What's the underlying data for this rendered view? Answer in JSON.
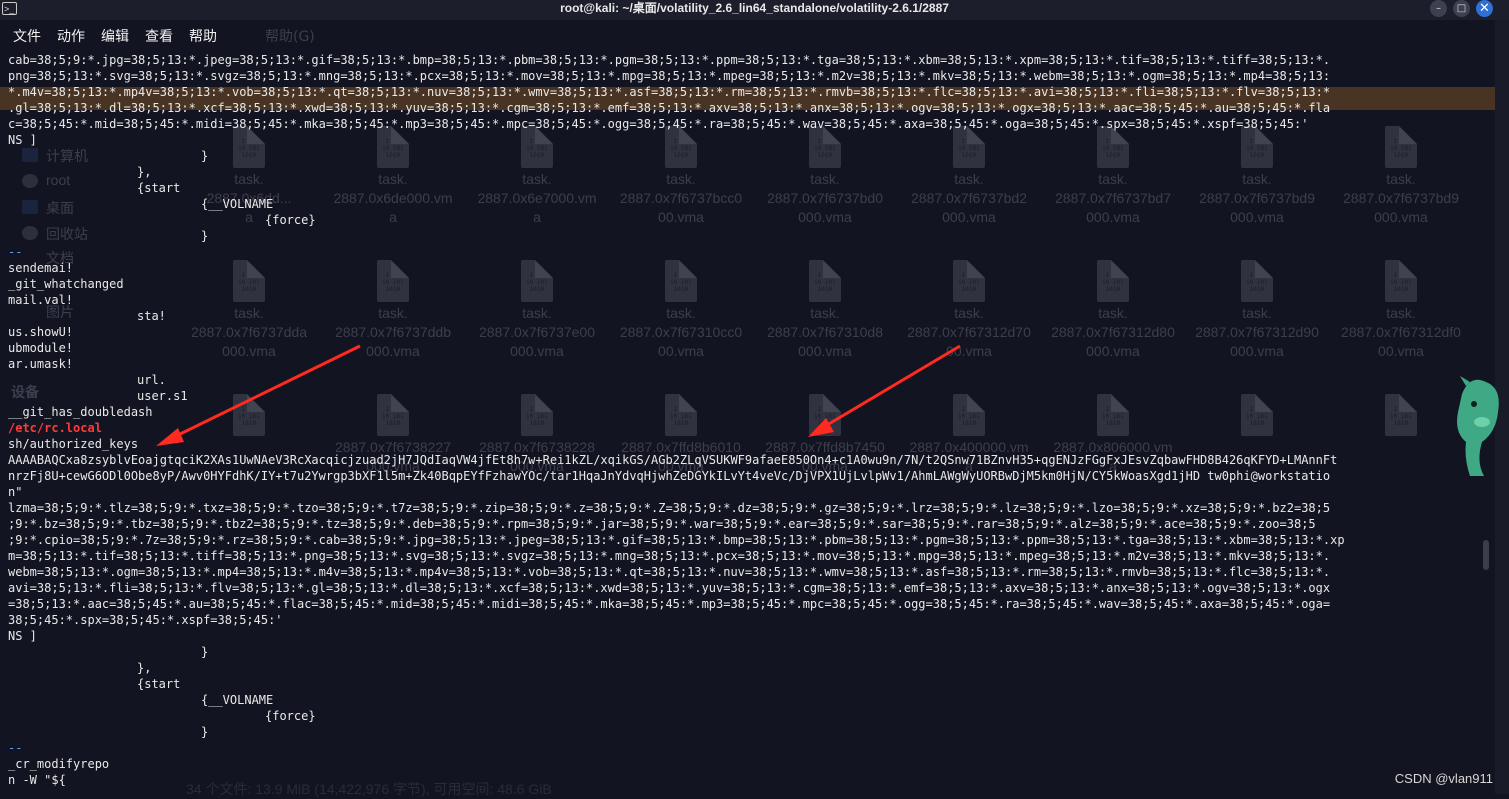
{
  "window": {
    "title": "root@kali: ~/桌面/volatility_2.6_lin64_standalone/volatility-2.6.1/2887",
    "app_icon": "terminal-icon",
    "buttons": [
      "minimize",
      "maximize",
      "close"
    ],
    "minimize_glyph": "–",
    "maximize_glyph": "□",
    "close_glyph": "✕"
  },
  "menu": {
    "items": [
      "文件",
      "动作",
      "编辑",
      "查看",
      "帮助"
    ],
    "ghost_item": "帮助(G)"
  },
  "ghost_filemanager": {
    "sidebar": [
      "计算机",
      "root",
      "桌面",
      "回收站",
      "文档",
      "图片",
      "设备"
    ],
    "rows": [
      [
        "task.\n2887.0x6dd...\na",
        "task.\n2887.0x6de000.vm\na",
        "task.\n2887.0x6e7000.vm\na",
        "task.\n2887.0x7f6737bcc0\n00.vma",
        "task.\n2887.0x7f6737bd0\n000.vma",
        "task.\n2887.0x7f6737bd2\n000.vma",
        "task.\n2887.0x7f6737bd7\n000.vma",
        "task.\n2887.0x7f6737bd9\n000.vma",
        "task.\n2887.0x7f6737bd9\n000.vma"
      ],
      [
        "task.\n2887.0x7f6737dda\n000.vma",
        "task.\n2887.0x7f6737ddb\n000.vma",
        "task.\n2887.0x7f6737e00\n000.vma",
        "task.\n2887.0x7f67310cc0\n00.vma",
        "task.\n2887.0x7f67310d8\n000.vma",
        "task.\n2887.0x7f67312d70\n00.vma",
        "task.\n2887.0x7f67312d80\n000.vma",
        "task.\n2887.0x7f67312d90\n000.vma",
        "task.\n2887.0x7f67312df0\n00.vma"
      ],
      [
        "",
        "2887.0x7f6738227\n000.vma",
        "2887.0x7f6738228\n000.vma",
        "2887.0x7ffd8b6010\n00.vma",
        "2887.0x7ffd8b7450\n00.vma",
        "2887.0x400000.vm\na",
        "2887.0x806000.vm\na",
        "",
        ""
      ]
    ],
    "status": "34 个文件: 13.9 MiB (14,422,976 字节), 可用空间: 48.6 GiB"
  },
  "terminal": {
    "top_lines": [
      "cab=38;5;9:*.jpg=38;5;13:*.jpeg=38;5;13:*.gif=38;5;13:*.bmp=38;5;13:*.pbm=38;5;13:*.pgm=38;5;13:*.ppm=38;5;13:*.tga=38;5;13:*.xbm=38;5;13:*.xpm=38;5;13:*.tif=38;5;13:*.tiff=38;5;13:*.",
      "png=38;5;13:*.svg=38;5;13:*.svgz=38;5;13:*.mng=38;5;13:*.pcx=38;5;13:*.mov=38;5;13:*.mpg=38;5;13:*.mpeg=38;5;13:*.m2v=38;5;13:*.mkv=38;5;13:*.webm=38;5;13:*.ogm=38;5;13:*.mp4=38;5;13:",
      "*.m4v=38;5;13:*.mp4v=38;5;13:*.vob=38;5;13:*.qt=38;5;13:*.nuv=38;5;13:*.wmv=38;5;13:*.asf=38;5;13:*.rm=38;5;13:*.rmvb=38;5;13:*.flc=38;5;13:*.avi=38;5;13:*.fli=38;5;13:*.flv=38;5;13:*",
      ".gl=38;5;13:*.dl=38;5;13:*.xcf=38;5;13:*.xwd=38;5;13:*.yuv=38;5;13:*.cgm=38;5;13:*.emf=38;5;13:*.axv=38;5;13:*.anx=38;5;13:*.ogv=38;5;13:*.ogx=38;5;13:*.aac=38;5;45:*.au=38;5;45:*.fla",
      "c=38;5;45:*.mid=38;5;45:*.midi=38;5;45:*.mka=38;5;45:*.mp3=38;5;45:*.mpc=38;5;45:*.ogg=38;5;45:*.ra=38;5;45:*.wav=38;5;45:*.axa=38;5;45:*.oga=38;5;45:*.spx=38;5;45:*.xspf=38;5;45:'",
      "NS ]"
    ],
    "block1": {
      "brace_close": "}",
      "inner_close": "},",
      "start": "{start",
      "volname": "{__VOLNAME",
      "force": "{force}",
      "brace2": "}"
    },
    "sep": "--",
    "left_words": [
      "sendemai!",
      "_git_whatchanged",
      "mail.val!",
      "sta!",
      "us.showU!",
      "ubmodule!",
      "ar.umask!",
      "url.",
      "user.s1",
      "__git_has_doubledash"
    ],
    "red_path": "/etc/rc.local",
    "keys_path": "sh/authorized_keys",
    "ssh_key_line1": "AAAABAQCxa8zsyblvEoajgtqciK2XAs1UwNAeV3RcXacqicjzuad2jH7JQdIaqVW4jfEt8h7w+Rei1kZL/xqikGS/AGb2ZLqVSUKWF9afaeE850On4+c1A0wu9n/7N/t2QSnw71BZnvH35+qgENJzFGgFxJEsvZqbawFHD8B426qKFYD+LMAnnFt",
    "ssh_key_line2": "nrzFj8U+cewG6ODl0Obe8yP/Awv0HYFdhK/IY+t7u2Ywrgp3bXF1l5m+Zk40BqpEYfFzhawYOc/tar1HqaJnYdvqHjwhZeDGYkILvYt4veVc/DjVPX1UjLvlpWv1/AhmLAWgWyUORBwDjM5km0HjN/CY5kWoasXgd1jHD tw0phi@workstatio",
    "ssh_key_line3": "n\"",
    "bottom_lines": [
      "lzma=38;5;9:*.tlz=38;5;9:*.txz=38;5;9:*.tzo=38;5;9:*.t7z=38;5;9:*.zip=38;5;9:*.z=38;5;9:*.Z=38;5;9:*.dz=38;5;9:*.gz=38;5;9:*.lrz=38;5;9:*.lz=38;5;9:*.lzo=38;5;9:*.xz=38;5;9:*.bz2=38;5",
      ";9:*.bz=38;5;9:*.tbz=38;5;9:*.tbz2=38;5;9:*.tz=38;5;9:*.deb=38;5;9:*.rpm=38;5;9:*.jar=38;5;9:*.war=38;5;9:*.ear=38;5;9:*.sar=38;5;9:*.rar=38;5;9:*.alz=38;5;9:*.ace=38;5;9:*.zoo=38;5",
      ";9:*.cpio=38;5;9:*.7z=38;5;9:*.rz=38;5;9:*.cab=38;5;9:*.jpg=38;5;13:*.jpeg=38;5;13:*.gif=38;5;13:*.bmp=38;5;13:*.pbm=38;5;13:*.pgm=38;5;13:*.ppm=38;5;13:*.tga=38;5;13:*.xbm=38;5;13:*.xp",
      "m=38;5;13:*.tif=38;5;13:*.tiff=38;5;13:*.png=38;5;13:*.svg=38;5;13:*.svgz=38;5;13:*.mng=38;5;13:*.pcx=38;5;13:*.mov=38;5;13:*.mpg=38;5;13:*.mpeg=38;5;13:*.m2v=38;5;13:*.mkv=38;5;13:*.",
      "webm=38;5;13:*.ogm=38;5;13:*.mp4=38;5;13:*.m4v=38;5;13:*.mp4v=38;5;13:*.vob=38;5;13:*.qt=38;5;13:*.nuv=38;5;13:*.wmv=38;5;13:*.asf=38;5;13:*.rm=38;5;13:*.rmvb=38;5;13:*.flc=38;5;13:*.",
      "avi=38;5;13:*.fli=38;5;13:*.flv=38;5;13:*.gl=38;5;13:*.dl=38;5;13:*.xcf=38;5;13:*.xwd=38;5;13:*.yuv=38;5;13:*.cgm=38;5;13:*.emf=38;5;13:*.axv=38;5;13:*.anx=38;5;13:*.ogv=38;5;13:*.ogx",
      "=38;5;13:*.aac=38;5;45:*.au=38;5;45:*.flac=38;5;45:*.mid=38;5;45:*.midi=38;5;45:*.mka=38;5;45:*.mp3=38;5;45:*.mpc=38;5;45:*.ogg=38;5;45:*.ra=38;5;45:*.wav=38;5;45:*.axa=38;5;45:*.oga=",
      "38;5;45:*.spx=38;5;45:*.xspf=38;5;45:'",
      "NS ]"
    ],
    "block2": {
      "brace_close": "}",
      "inner_close": "},",
      "start": "{start",
      "volname": "{__VOLNAME",
      "force": "{force}",
      "brace2": "}"
    },
    "tail_sep": "--",
    "tail_lines": [
      "_cr_modifyrepo",
      "n -W \"${"
    ]
  },
  "watermark": "CSDN @vlan911",
  "colors": {
    "background": "#131421",
    "text": "#e9e9e9",
    "highlight_path": "#ff3a3a",
    "arrow": "#ff2a20",
    "close_button": "#2f6fd6"
  }
}
